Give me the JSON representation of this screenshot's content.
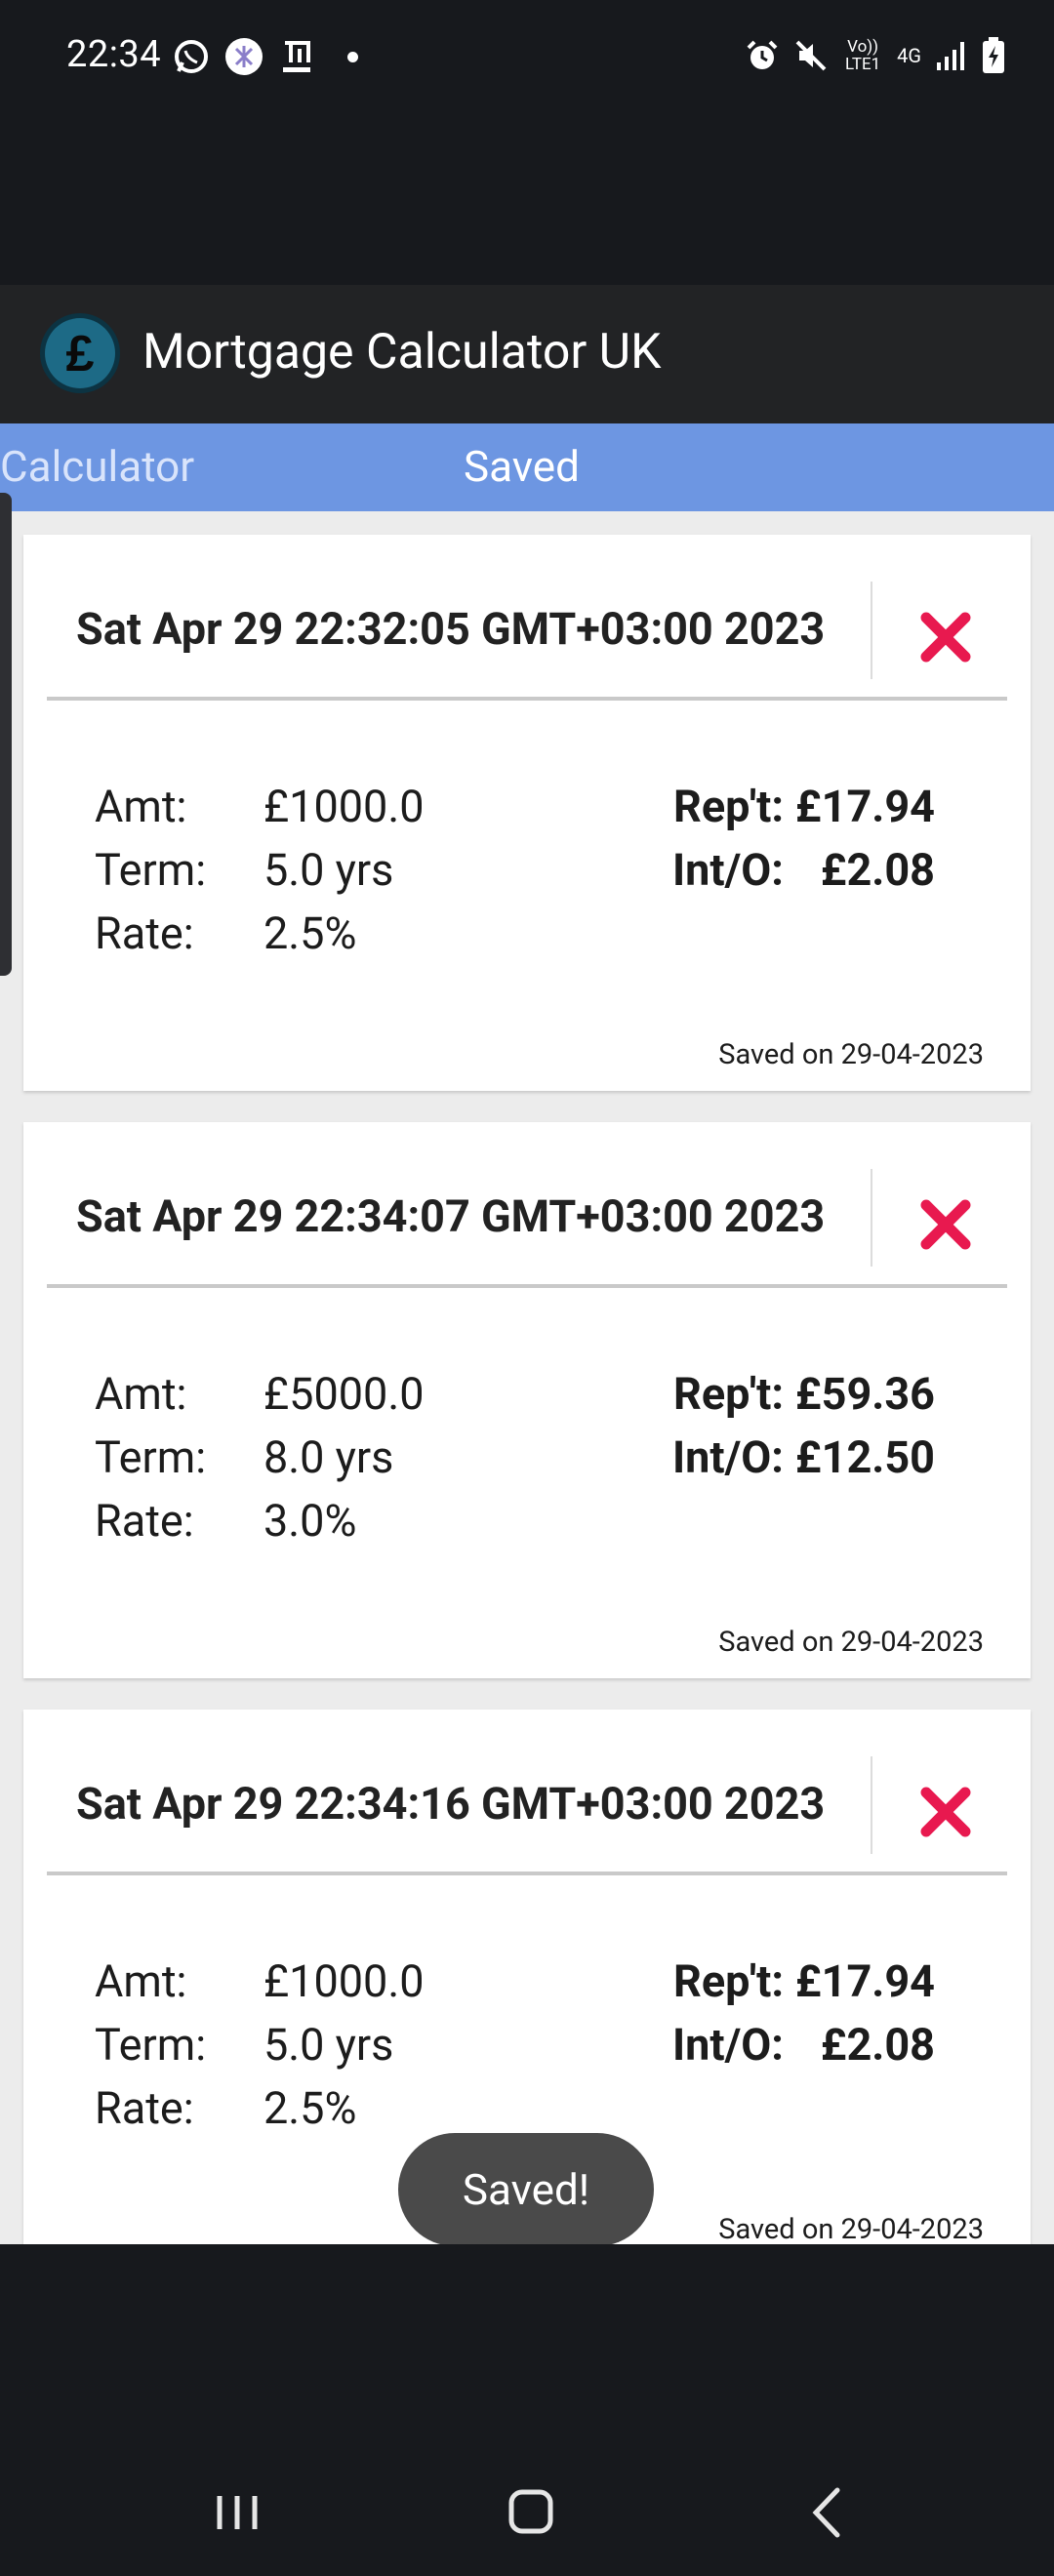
{
  "status_bar": {
    "time": "22:34",
    "left_icons": [
      "whatsapp-icon",
      "app-icon",
      "hebrew-app-icon",
      "dot-icon"
    ],
    "right_icons": [
      "alarm-icon",
      "mute-icon",
      "volte-icon",
      "4g-icon",
      "signal-icon",
      "battery-charging-icon"
    ],
    "volte_text": "Vo)) LTE1",
    "network_text": "4G"
  },
  "app": {
    "title": "Mortgage Calculator UK",
    "logo_icon": "pound-sign-icon"
  },
  "tabs": [
    {
      "label": "Calculator",
      "active": false
    },
    {
      "label": "Saved",
      "active": true
    }
  ],
  "cards": [
    {
      "title": "Sat Apr 29 22:32:05 GMT+03:00 2023",
      "amount_label": "Amt:",
      "amount": "£1000.0",
      "term_label": "Term:",
      "term": "5.0 yrs",
      "rate_label": "Rate:",
      "rate": "2.5%",
      "repayment_label": "Rep't:",
      "repayment": "£17.94",
      "interest_label": "Int/O:",
      "interest": "£2.08",
      "saved_on": "Saved on 29-04-2023"
    },
    {
      "title": "Sat Apr 29 22:34:07 GMT+03:00 2023",
      "amount_label": "Amt:",
      "amount": "£5000.0",
      "term_label": "Term:",
      "term": "8.0 yrs",
      "rate_label": "Rate:",
      "rate": "3.0%",
      "repayment_label": "Rep't:",
      "repayment": "£59.36",
      "interest_label": "Int/O:",
      "interest": "£12.50",
      "saved_on": "Saved on 29-04-2023"
    },
    {
      "title": "Sat Apr 29 22:34:16 GMT+03:00 2023",
      "amount_label": "Amt:",
      "amount": "£1000.0",
      "term_label": "Term:",
      "term": "5.0 yrs",
      "rate_label": "Rate:",
      "rate": "2.5%",
      "repayment_label": "Rep't:",
      "repayment": "£17.94",
      "interest_label": "Int/O:",
      "interest": "£2.08",
      "saved_on": "Saved on 29-04-2023"
    }
  ],
  "toast": "Saved!",
  "nav": [
    "recent-apps-icon",
    "home-icon",
    "back-icon"
  ],
  "colors": {
    "tab_bar": "#6d96e2",
    "delete": "#e8194f",
    "action_bar": "#222325",
    "logo": "#1d6a86"
  }
}
